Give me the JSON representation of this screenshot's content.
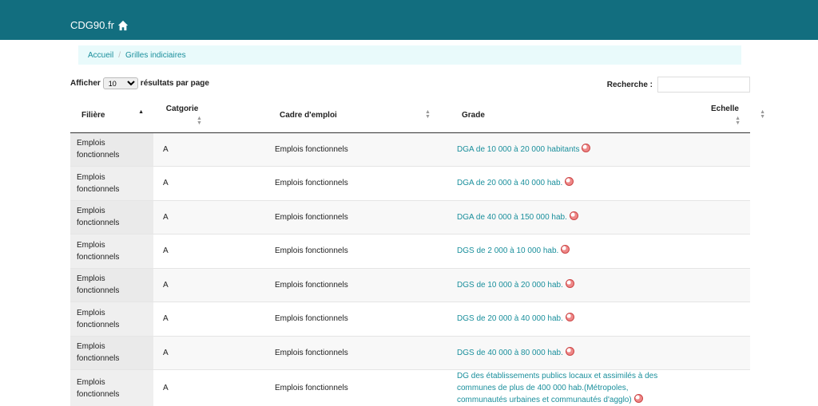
{
  "header": {
    "brand": "CDG90.fr",
    "home_icon": "home-icon"
  },
  "breadcrumb": {
    "items": [
      "Accueil",
      "Grilles indiciaires"
    ]
  },
  "controls": {
    "show_label": "Afficher",
    "page_size": "10",
    "per_page_label": "résultats par page",
    "search_label": "Recherche :",
    "search_value": ""
  },
  "table": {
    "columns": [
      "Filière",
      "Catgorie",
      "Cadre d'emploi",
      "Grade",
      "Echelle"
    ],
    "rows": [
      [
        "Emplois fonctionnels",
        "A",
        "Emplois fonctionnels",
        "DGA de 10 000 à 20 000 habitants",
        ""
      ],
      [
        "Emplois fonctionnels",
        "A",
        "Emplois fonctionnels",
        "DGA de 20 000 à 40 000 hab.",
        ""
      ],
      [
        "Emplois fonctionnels",
        "A",
        "Emplois fonctionnels",
        "DGA de 40 000 à 150 000 hab.",
        ""
      ],
      [
        "Emplois fonctionnels",
        "A",
        "Emplois fonctionnels",
        "DGS de 2 000 à 10 000 hab.",
        ""
      ],
      [
        "Emplois fonctionnels",
        "A",
        "Emplois fonctionnels",
        "DGS de 10 000 à 20 000 hab.",
        ""
      ],
      [
        "Emplois fonctionnels",
        "A",
        "Emplois fonctionnels",
        "DGS de 20 000 à 40 000 hab.",
        ""
      ],
      [
        "Emplois fonctionnels",
        "A",
        "Emplois fonctionnels",
        "DGS de 40 000 à 80 000 hab.",
        ""
      ],
      [
        "Emplois fonctionnels",
        "A",
        "Emplois fonctionnels",
        "DG des établissements publics locaux et assimilés à des communes de plus de 400 000 hab.(Métropoles, communautés urbaines et communautés d'agglo)",
        ""
      ]
    ]
  },
  "colors": {
    "header_bg": "#126e7f",
    "link": "#1a8f9c",
    "breadcrumb_bg": "#e9fafb"
  }
}
